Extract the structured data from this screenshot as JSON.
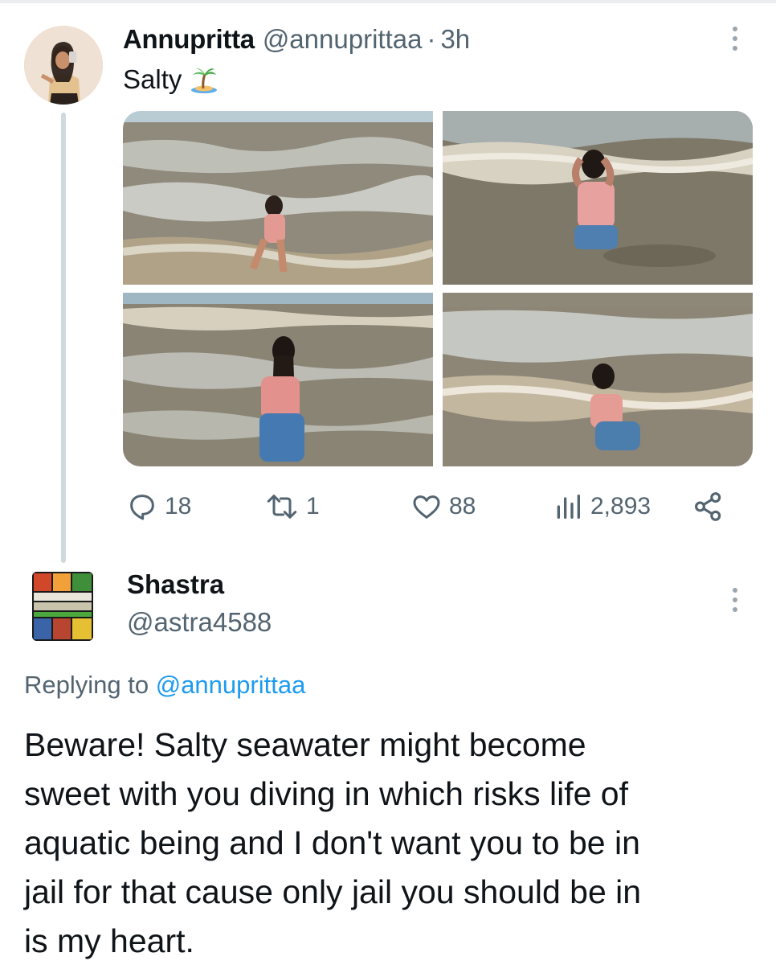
{
  "tweet": {
    "author": {
      "display_name": "Annupritta",
      "handle": "@annuprittaa",
      "separator": "·",
      "time": "3h"
    },
    "text": "Salty",
    "emoji": "🏝️",
    "photos": [
      {
        "label": "woman seated in shallow surf, top-left"
      },
      {
        "label": "woman in pink top in waves, top-right"
      },
      {
        "label": "woman standing in sea, back view, bottom-left"
      },
      {
        "label": "woman kneeling in shallow water, bottom-right"
      }
    ],
    "stats": {
      "replies": "18",
      "retweets": "1",
      "likes": "88",
      "views": "2,893"
    }
  },
  "reply": {
    "author": {
      "display_name": "Shastra",
      "handle": "@astra4588"
    },
    "replying_prefix": "Replying to ",
    "replying_to": "@annuprittaa",
    "lines": [
      "Beware! Salty seawater might become",
      "sweet with you diving in which risks life of",
      "aquatic being and I don't want you to be in",
      "jail for that cause only jail you should be in",
      "is my heart."
    ]
  },
  "colors": {
    "text_primary": "#0f1419",
    "text_secondary": "#536471",
    "link": "#1d9bf0",
    "thread_line": "#cfd9de"
  },
  "icons": [
    "reply-icon",
    "retweet-icon",
    "like-icon",
    "views-icon",
    "share-icon",
    "more-icon",
    "island-emoji"
  ]
}
